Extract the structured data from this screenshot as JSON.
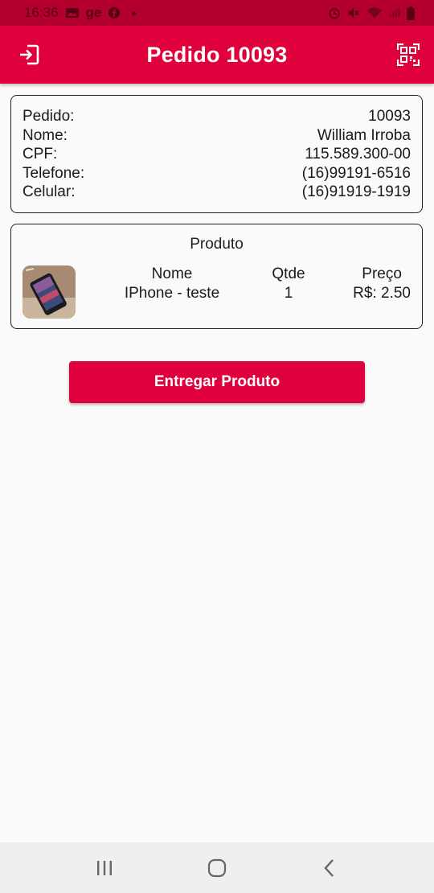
{
  "status_bar": {
    "time": "16:36",
    "carrier_text": "ge"
  },
  "app_bar": {
    "title": "Pedido 10093",
    "left_icon": "logout-icon",
    "right_icon": "qr-code-icon",
    "color": "#e0003c"
  },
  "order_info": {
    "rows": [
      {
        "label": "Pedido:",
        "value": "10093"
      },
      {
        "label": "Nome:",
        "value": "William Irroba"
      },
      {
        "label": "CPF:",
        "value": "115.589.300-00"
      },
      {
        "label": "Telefone:",
        "value": "(16)99191-6516"
      },
      {
        "label": "Celular:",
        "value": "(16)91919-1919"
      }
    ]
  },
  "product": {
    "heading": "Produto",
    "columns": {
      "nome": "Nome",
      "qtde": "Qtde",
      "preco": "Preço"
    },
    "item": {
      "nome": "IPhone - teste",
      "qtde": "1",
      "preco": "R$: 2.50"
    }
  },
  "actions": {
    "deliver_label": "Entregar Produto"
  },
  "nav_bar": {
    "icons": [
      "recent-apps-icon",
      "home-icon",
      "back-icon"
    ]
  }
}
